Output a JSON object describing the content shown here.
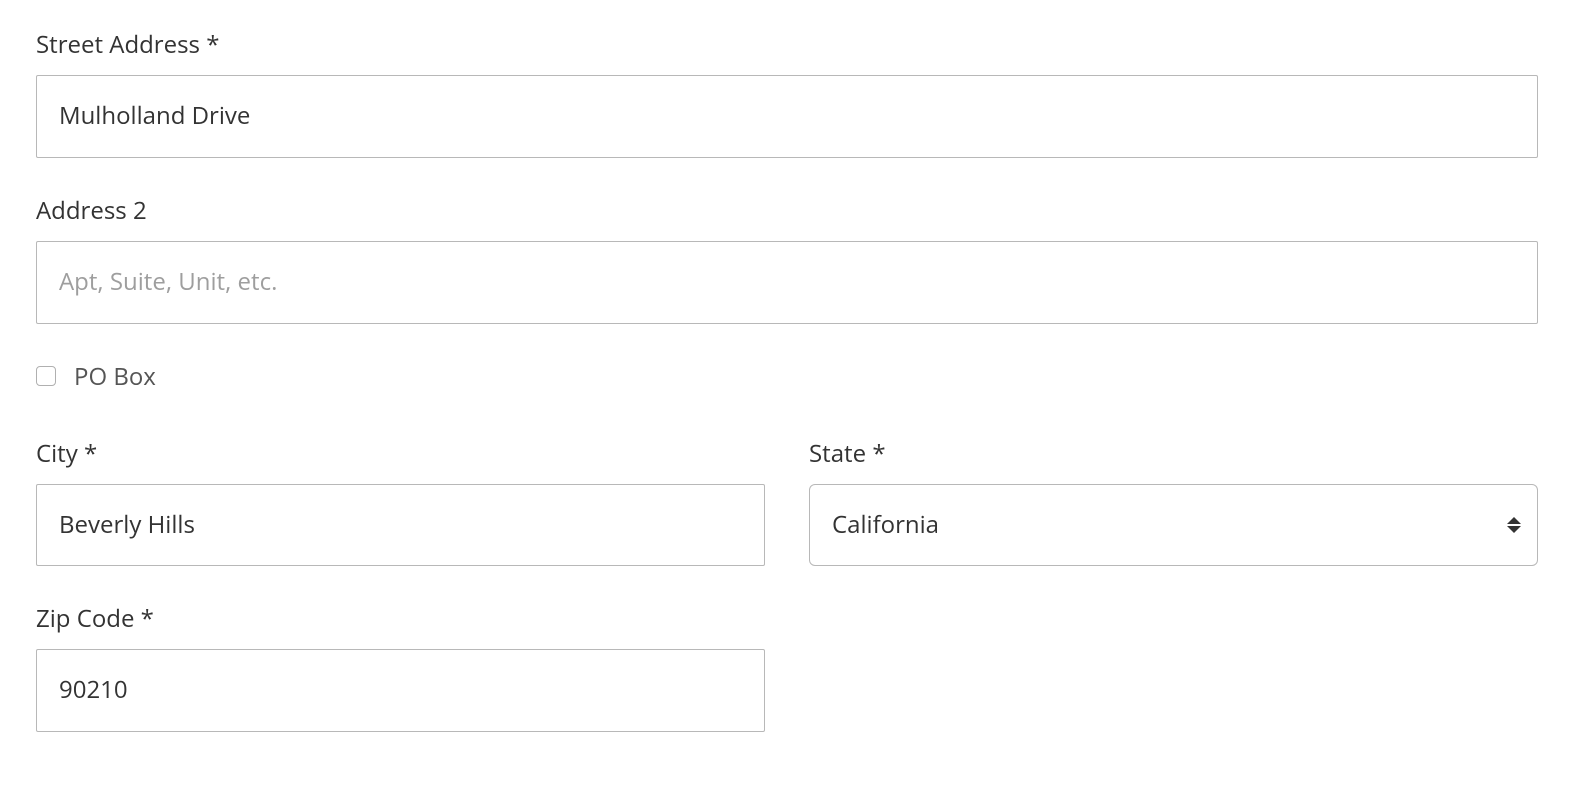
{
  "form": {
    "street_address": {
      "label": "Street Address *",
      "value": "Mulholland Drive"
    },
    "address2": {
      "label": "Address 2",
      "value": "",
      "placeholder": "Apt, Suite, Unit, etc."
    },
    "po_box": {
      "label": "PO Box",
      "checked": false
    },
    "city": {
      "label": "City *",
      "value": "Beverly Hills"
    },
    "state": {
      "label": "State *",
      "value": "California"
    },
    "zip": {
      "label": "Zip Code *",
      "value": "90210"
    }
  }
}
